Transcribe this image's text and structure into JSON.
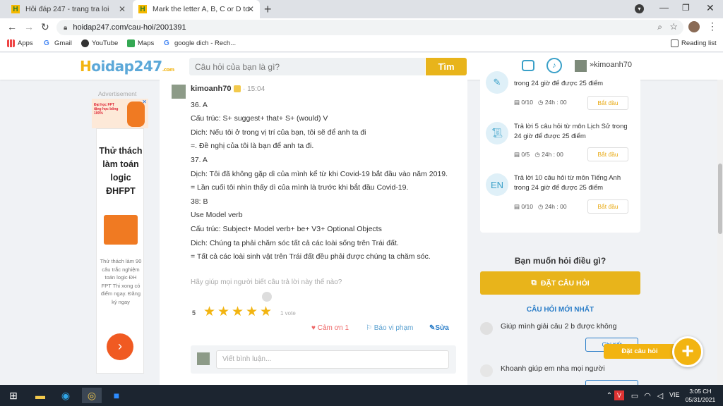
{
  "browser": {
    "tabs": [
      {
        "title": "Hỏi đáp 247 - trang tra loi",
        "active": false
      },
      {
        "title": "Mark the letter A, B, C or D to inc",
        "active": true
      }
    ],
    "url": "hoidap247.com/cau-hoi/2001391",
    "bookmarks": [
      "Apps",
      "Gmail",
      "YouTube",
      "Maps",
      "google dich - Rech..."
    ],
    "reading_list": "Reading list"
  },
  "site": {
    "logo_h": "H",
    "logo_rest": "oidap247",
    "logo_sub": ".com",
    "search_placeholder": "Câu hỏi của bạn là gì?",
    "search_button": "Tìm",
    "username": "kimoanh70"
  },
  "ad": {
    "label": "Advertisement",
    "promo_line1": "Đại học FPT tặng học bổng 100%",
    "headline": "Thử thách làm toán logic ĐHFPT",
    "body": "Thử thách làm 90 câu trắc nghiệm toán logic ĐH FPT Thi xong có điểm ngay. Đăng ký ngay"
  },
  "answer": {
    "author": "kimoanh70",
    "time": "15:04",
    "lines": [
      "36. A",
      "Cấu trúc: S+ suggest+ that+ S+ (would) V",
      "Dich: Nếu tôi ở trong vị trí của bạn, tôi sẽ để anh ta đi",
      "=. Đề nghị của tôi là bạn để anh ta đi.",
      "37. A",
      "Dịch: Tôi đã không gặp dì của mình kể từ khi Covid-19 bắt đầu vào năm 2019.",
      "= Lần cuối tôi nhìn thấy dì của mình là trước khi bắt đầu Covid-19.",
      "38: B",
      " Use Model verb",
      "Cấu trúc: Subject+ Model verb+ be+ V3+ Optional Objects",
      "Dich: Chúng ta phải chăm sóc tất cả các loài sống trên Trái đất.",
      "= Tất cả các loài sinh vật trên Trái đất đều phải được chúng ta chăm sóc."
    ],
    "rating_prompt": "Hãy giúp mọi người biết câu trả lời này thế nào?",
    "rating_value": "5",
    "rating_stars": 5,
    "vote_count": "1 vote",
    "thanks": "Cảm ơn 1",
    "report": "Báo vi phạm",
    "edit": "Sửa",
    "comment_placeholder": "Viết bình luận..."
  },
  "tasks": [
    {
      "text": "trong 24 giờ để được 25 điểm",
      "progress": "0/10",
      "time": "24h : 00",
      "button": "Bắt đầu"
    },
    {
      "text": "Trả lời 5 câu hỏi  từ môn Lịch Sử trong 24 giờ để được 25 điểm",
      "progress": "0/5",
      "time": "24h : 00",
      "button": "Bắt đầu"
    },
    {
      "text": "Trả lời 10 câu hỏi  từ môn Tiếng Anh trong 24 giờ để được 25 điểm",
      "progress": "0/10",
      "time": "24h : 00",
      "button": "Bắt đầu"
    }
  ],
  "ask": {
    "heading": "Bạn muốn hỏi điều gì?",
    "button": "ĐẶT CÂU HỎI",
    "latest_heading": "CÂU HỎI MỚI NHẤT",
    "latest": [
      "Giúp mình giải câu 2 b được không",
      "Khoanh giúp em nha mọi người"
    ],
    "detail_button": "Chi tiết",
    "fab_label": "Đặt câu hỏi"
  },
  "taskbar": {
    "lang": "VIE",
    "time": "3:05 CH",
    "date": "05/31/2021"
  },
  "colors": {
    "accent": "#e8b41b",
    "brand_blue": "#5ca8d8"
  }
}
